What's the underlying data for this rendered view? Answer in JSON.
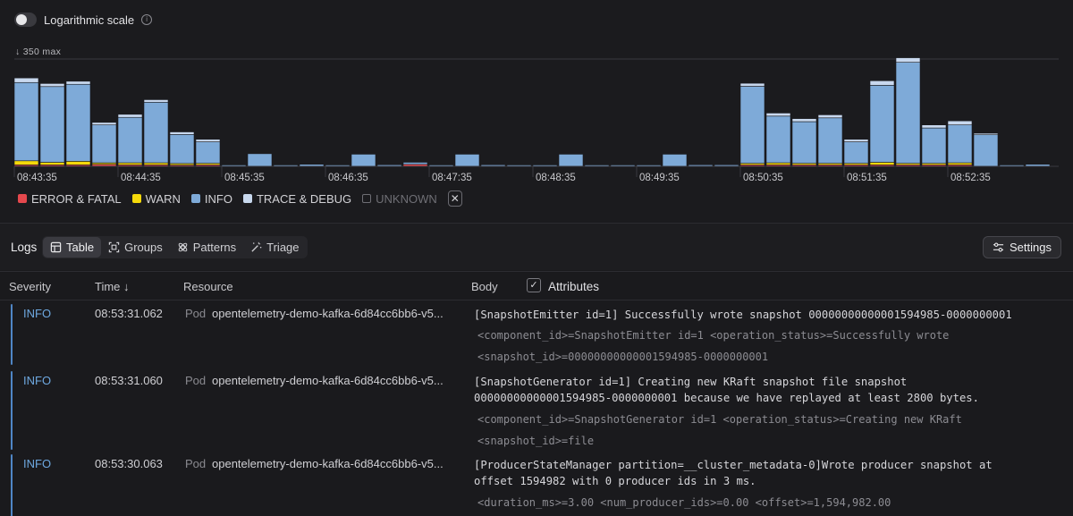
{
  "histogram": {
    "toggle_label": "Logarithmic scale",
    "max_label": "↓ 350 max",
    "colors": {
      "error": "#e5484d",
      "warn": "#f5d90a",
      "info": "#7eaad8",
      "trace": "#c8d8ee",
      "unknown": "#6e6e74"
    },
    "time_labels": [
      "08:43:35",
      "08:44:35",
      "08:45:35",
      "08:46:35",
      "08:47:35",
      "08:48:35",
      "08:49:35",
      "08:50:35",
      "08:51:35",
      "08:52:35"
    ],
    "buckets": [
      {
        "info": 310,
        "trace": 18,
        "warn": 16,
        "error": 6
      },
      {
        "info": 300,
        "trace": 12,
        "warn": 10,
        "error": 6
      },
      {
        "info": 305,
        "trace": 12,
        "warn": 14,
        "error": 6
      },
      {
        "info": 150,
        "trace": 10,
        "warn": 6,
        "error": 8
      },
      {
        "info": 180,
        "trace": 12,
        "warn": 8,
        "error": 6
      },
      {
        "info": 240,
        "trace": 10,
        "warn": 8,
        "error": 6
      },
      {
        "info": 115,
        "trace": 10,
        "warn": 6,
        "error": 4
      },
      {
        "info": 85,
        "trace": 10,
        "warn": 6,
        "error": 6
      },
      {
        "info": 4,
        "trace": 0,
        "warn": 0,
        "error": 0
      },
      {
        "info": 50,
        "trace": 0,
        "warn": 0,
        "error": 0
      },
      {
        "info": 4,
        "trace": 0,
        "warn": 0,
        "error": 0
      },
      {
        "info": 8,
        "trace": 0,
        "warn": 0,
        "error": 0
      },
      {
        "info": 5,
        "trace": 0,
        "warn": 0,
        "error": 0
      },
      {
        "info": 48,
        "trace": 0,
        "warn": 0,
        "error": 0
      },
      {
        "info": 6,
        "trace": 0,
        "warn": 0,
        "error": 0
      },
      {
        "info": 8,
        "trace": 0,
        "warn": 0,
        "error": 8
      },
      {
        "info": 5,
        "trace": 0,
        "warn": 0,
        "error": 0
      },
      {
        "info": 48,
        "trace": 0,
        "warn": 0,
        "error": 0
      },
      {
        "info": 6,
        "trace": 0,
        "warn": 0,
        "error": 0
      },
      {
        "info": 5,
        "trace": 0,
        "warn": 0,
        "error": 0
      },
      {
        "info": 4,
        "trace": 0,
        "warn": 0,
        "error": 0
      },
      {
        "info": 48,
        "trace": 0,
        "warn": 0,
        "error": 0
      },
      {
        "info": 5,
        "trace": 0,
        "warn": 0,
        "error": 0
      },
      {
        "info": 5,
        "trace": 0,
        "warn": 0,
        "error": 0
      },
      {
        "info": 4,
        "trace": 0,
        "warn": 0,
        "error": 0
      },
      {
        "info": 48,
        "trace": 0,
        "warn": 0,
        "error": 0
      },
      {
        "info": 6,
        "trace": 0,
        "warn": 0,
        "error": 0
      },
      {
        "info": 6,
        "trace": 0,
        "warn": 0,
        "error": 0
      },
      {
        "info": 305,
        "trace": 12,
        "warn": 6,
        "error": 6
      },
      {
        "info": 185,
        "trace": 12,
        "warn": 8,
        "error": 6
      },
      {
        "info": 165,
        "trace": 12,
        "warn": 6,
        "error": 6
      },
      {
        "info": 180,
        "trace": 12,
        "warn": 6,
        "error": 6
      },
      {
        "info": 85,
        "trace": 10,
        "warn": 6,
        "error": 6
      },
      {
        "info": 305,
        "trace": 18,
        "warn": 10,
        "error": 6
      },
      {
        "info": 400,
        "trace": 18,
        "warn": 6,
        "error": 6
      },
      {
        "info": 140,
        "trace": 12,
        "warn": 6,
        "error": 6
      },
      {
        "info": 150,
        "trace": 16,
        "warn": 8,
        "error": 6
      },
      {
        "info": 125,
        "trace": 6,
        "warn": 0,
        "error": 0
      },
      {
        "info": 5,
        "trace": 0,
        "warn": 0,
        "error": 0
      },
      {
        "info": 8,
        "trace": 0,
        "warn": 0,
        "error": 0
      }
    ],
    "legend": [
      {
        "label": "ERROR & FATAL",
        "key": "error"
      },
      {
        "label": "WARN",
        "key": "warn"
      },
      {
        "label": "INFO",
        "key": "info"
      },
      {
        "label": "TRACE & DEBUG",
        "key": "trace"
      },
      {
        "label": "UNKNOWN",
        "key": "unknown"
      }
    ],
    "legend_close": "✕"
  },
  "toolbar": {
    "logs_label": "Logs",
    "tabs": [
      {
        "label": "Table",
        "icon": "table-icon"
      },
      {
        "label": "Groups",
        "icon": "groups-icon"
      },
      {
        "label": "Patterns",
        "icon": "patterns-icon"
      },
      {
        "label": "Triage",
        "icon": "magic-wand-icon"
      }
    ],
    "settings_label": "Settings"
  },
  "table": {
    "headers": {
      "severity": "Severity",
      "time": "Time ↓",
      "resource": "Resource",
      "body": "Body",
      "attributes": "Attributes"
    },
    "checkbox_mark": "✓",
    "rows": [
      {
        "severity": "INFO",
        "time": "08:53:31.062",
        "resource_type": "Pod",
        "resource": "opentelemetry-demo-kafka-6d84cc6bb6-v5...",
        "body": "[SnapshotEmitter id=1] Successfully wrote snapshot 00000000000001594985-0000000001",
        "attributes": [
          "<component_id>=SnapshotEmitter id=1 <operation_status>=Successfully wrote",
          "<snapshot_id>=00000000000001594985-0000000001"
        ]
      },
      {
        "severity": "INFO",
        "time": "08:53:31.060",
        "resource_type": "Pod",
        "resource": "opentelemetry-demo-kafka-6d84cc6bb6-v5...",
        "body": "[SnapshotGenerator id=1] Creating new KRaft snapshot file snapshot\n00000000000001594985-0000000001 because we have replayed at least 2800 bytes.",
        "attributes": [
          "<component_id>=SnapshotGenerator id=1 <operation_status>=Creating new KRaft",
          "<snapshot_id>=file"
        ]
      },
      {
        "severity": "INFO",
        "time": "08:53:30.063",
        "resource_type": "Pod",
        "resource": "opentelemetry-demo-kafka-6d84cc6bb6-v5...",
        "body": "[ProducerStateManager partition=__cluster_metadata-0]Wrote producer snapshot at\noffset 1594982 with 0 producer ids in 3 ms.",
        "attributes": [
          "<duration_ms>=3.00 <num_producer_ids>=0.00 <offset>=1,594,982.00"
        ]
      }
    ]
  }
}
